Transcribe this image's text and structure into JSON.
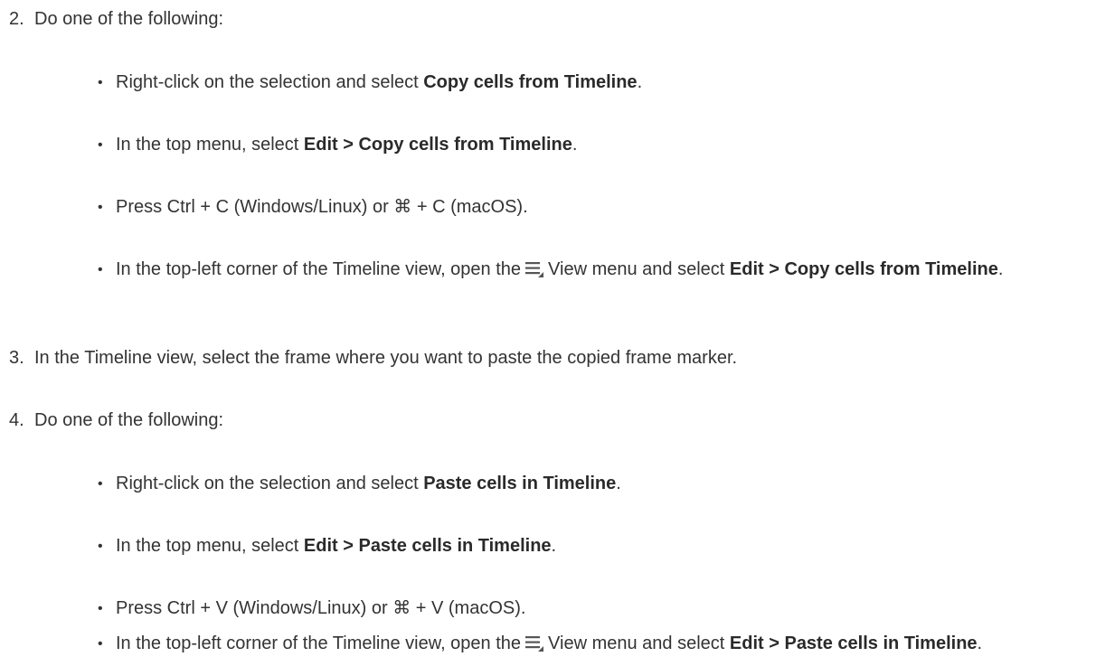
{
  "steps": [
    {
      "number": "2.",
      "text": "Do one of the following:",
      "bullets": [
        {
          "pre": "Right-click on the selection and select ",
          "bold": "Copy cells from Timeline",
          "post": "."
        },
        {
          "pre": "In the top menu, select ",
          "bold": "Edit > Copy cells from Timeline",
          "post": "."
        },
        {
          "pre": "Press Ctrl + C (Windows/Linux) or ⌘ + C (macOS).",
          "bold": "",
          "post": ""
        },
        {
          "pre": "In the top-left corner of the Timeline view, open the",
          "icon": "view-menu-icon",
          "mid": "View menu and select ",
          "bold": "Edit > Copy cells from Timeline",
          "post": "."
        }
      ]
    },
    {
      "number": "3.",
      "text": "In the Timeline view, select the frame where you want to paste the copied frame marker."
    },
    {
      "number": "4.",
      "text": "Do one of the following:",
      "bullets": [
        {
          "pre": "Right-click on the selection and select ",
          "bold": "Paste cells in Timeline",
          "post": "."
        },
        {
          "pre": "In the top menu, select ",
          "bold": "Edit > Paste cells in Timeline",
          "post": "."
        },
        {
          "pre": "Press Ctrl + V (Windows/Linux) or ⌘ + V (macOS).",
          "bold": "",
          "post": ""
        },
        {
          "pre": "In the top-left corner of the Timeline view, open the",
          "icon": "view-menu-icon",
          "mid": "View menu and select ",
          "bold": "Edit > Paste cells in Timeline",
          "post": "."
        }
      ]
    }
  ]
}
